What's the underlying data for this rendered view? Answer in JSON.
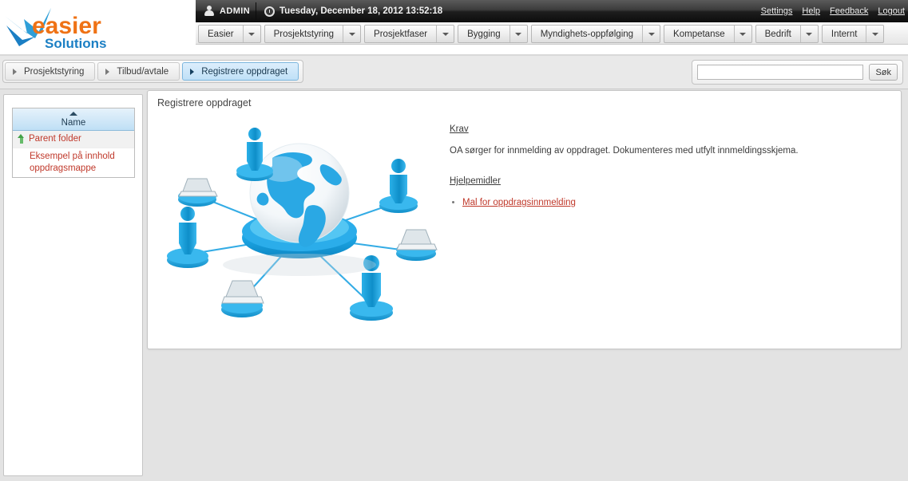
{
  "brand": {
    "name_primary": "easier",
    "name_secondary": "Solutions",
    "primary_color": "#ef7215",
    "secondary_color": "#1b7fc4"
  },
  "adminbar": {
    "user_icon": "user-icon",
    "user": "ADMIN",
    "clock_icon": "clock-icon",
    "datetime": "Tuesday, December 18, 2012 13:52:18",
    "links": [
      {
        "label": "Settings"
      },
      {
        "label": "Help"
      },
      {
        "label": "Feedback"
      },
      {
        "label": "Logout"
      }
    ]
  },
  "menubar": {
    "caret_icon": "chevron-down-icon",
    "items": [
      {
        "label": "Easier"
      },
      {
        "label": "Prosjektstyring"
      },
      {
        "label": "Prosjektfaser"
      },
      {
        "label": "Bygging"
      },
      {
        "label": "Myndighets-oppfølging"
      },
      {
        "label": "Kompetanse"
      },
      {
        "label": "Bedrift"
      },
      {
        "label": "Internt"
      }
    ]
  },
  "breadcrumb": {
    "items": [
      {
        "label": "Prosjektstyring",
        "active": false
      },
      {
        "label": "Tilbud/avtale",
        "active": false
      },
      {
        "label": "Registrere oppdraget",
        "active": true
      }
    ]
  },
  "search": {
    "value": "",
    "placeholder": "",
    "button_label": "Søk"
  },
  "sidebar": {
    "column_header": "Name",
    "sort_direction": "ascending",
    "rows": [
      {
        "label": "Parent folder",
        "icon": "up-arrow-icon",
        "has_icon": true
      },
      {
        "label": "Eksempel på innhold oppdragsmappe",
        "icon": "",
        "has_icon": false
      }
    ]
  },
  "main": {
    "title": "Registrere oppdraget",
    "illustration": "global-network-globe-illustration",
    "sections": [
      {
        "heading": "Krav",
        "text": "OA sørger for innmelding av oppdraget. Dokumenteres med utfylt innmeldingsskjema."
      },
      {
        "heading": "Hjelpemidler",
        "links": [
          {
            "label": "Mal for oppdragsinnmelding"
          }
        ]
      }
    ]
  },
  "flat": {
    "krav_heading": "Krav",
    "krav_text": "OA sørger for innmelding av oppdraget. Dokumenteres med utfylt innmeldingsskjema.",
    "hjelpemidler_heading": "Hjelpemidler",
    "hjelpemidler_link_1": "Mal for oppdragsinnmelding"
  }
}
